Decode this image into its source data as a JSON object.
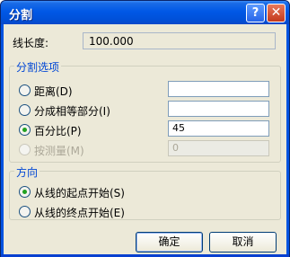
{
  "window": {
    "title": "分割"
  },
  "line_length": {
    "label": "线长度:",
    "value": "100.000"
  },
  "split_options": {
    "legend": "分割选项",
    "options": [
      {
        "label": "距离(D)",
        "value": "",
        "checked": false,
        "enabled": true
      },
      {
        "label": "分成相等部分(I)",
        "value": "",
        "checked": false,
        "enabled": true
      },
      {
        "label": "百分比(P)",
        "value": "45",
        "checked": true,
        "enabled": true
      },
      {
        "label": "按测量(M)",
        "value": "0",
        "checked": false,
        "enabled": false
      }
    ]
  },
  "direction": {
    "legend": "方向",
    "options": [
      {
        "label": "从线的起点开始(S)",
        "checked": true
      },
      {
        "label": "从线的终点开始(E)",
        "checked": false
      }
    ]
  },
  "buttons": {
    "ok": "确定",
    "cancel": "取消"
  },
  "titlebar_buttons": {
    "help": "?",
    "close": "✕"
  }
}
